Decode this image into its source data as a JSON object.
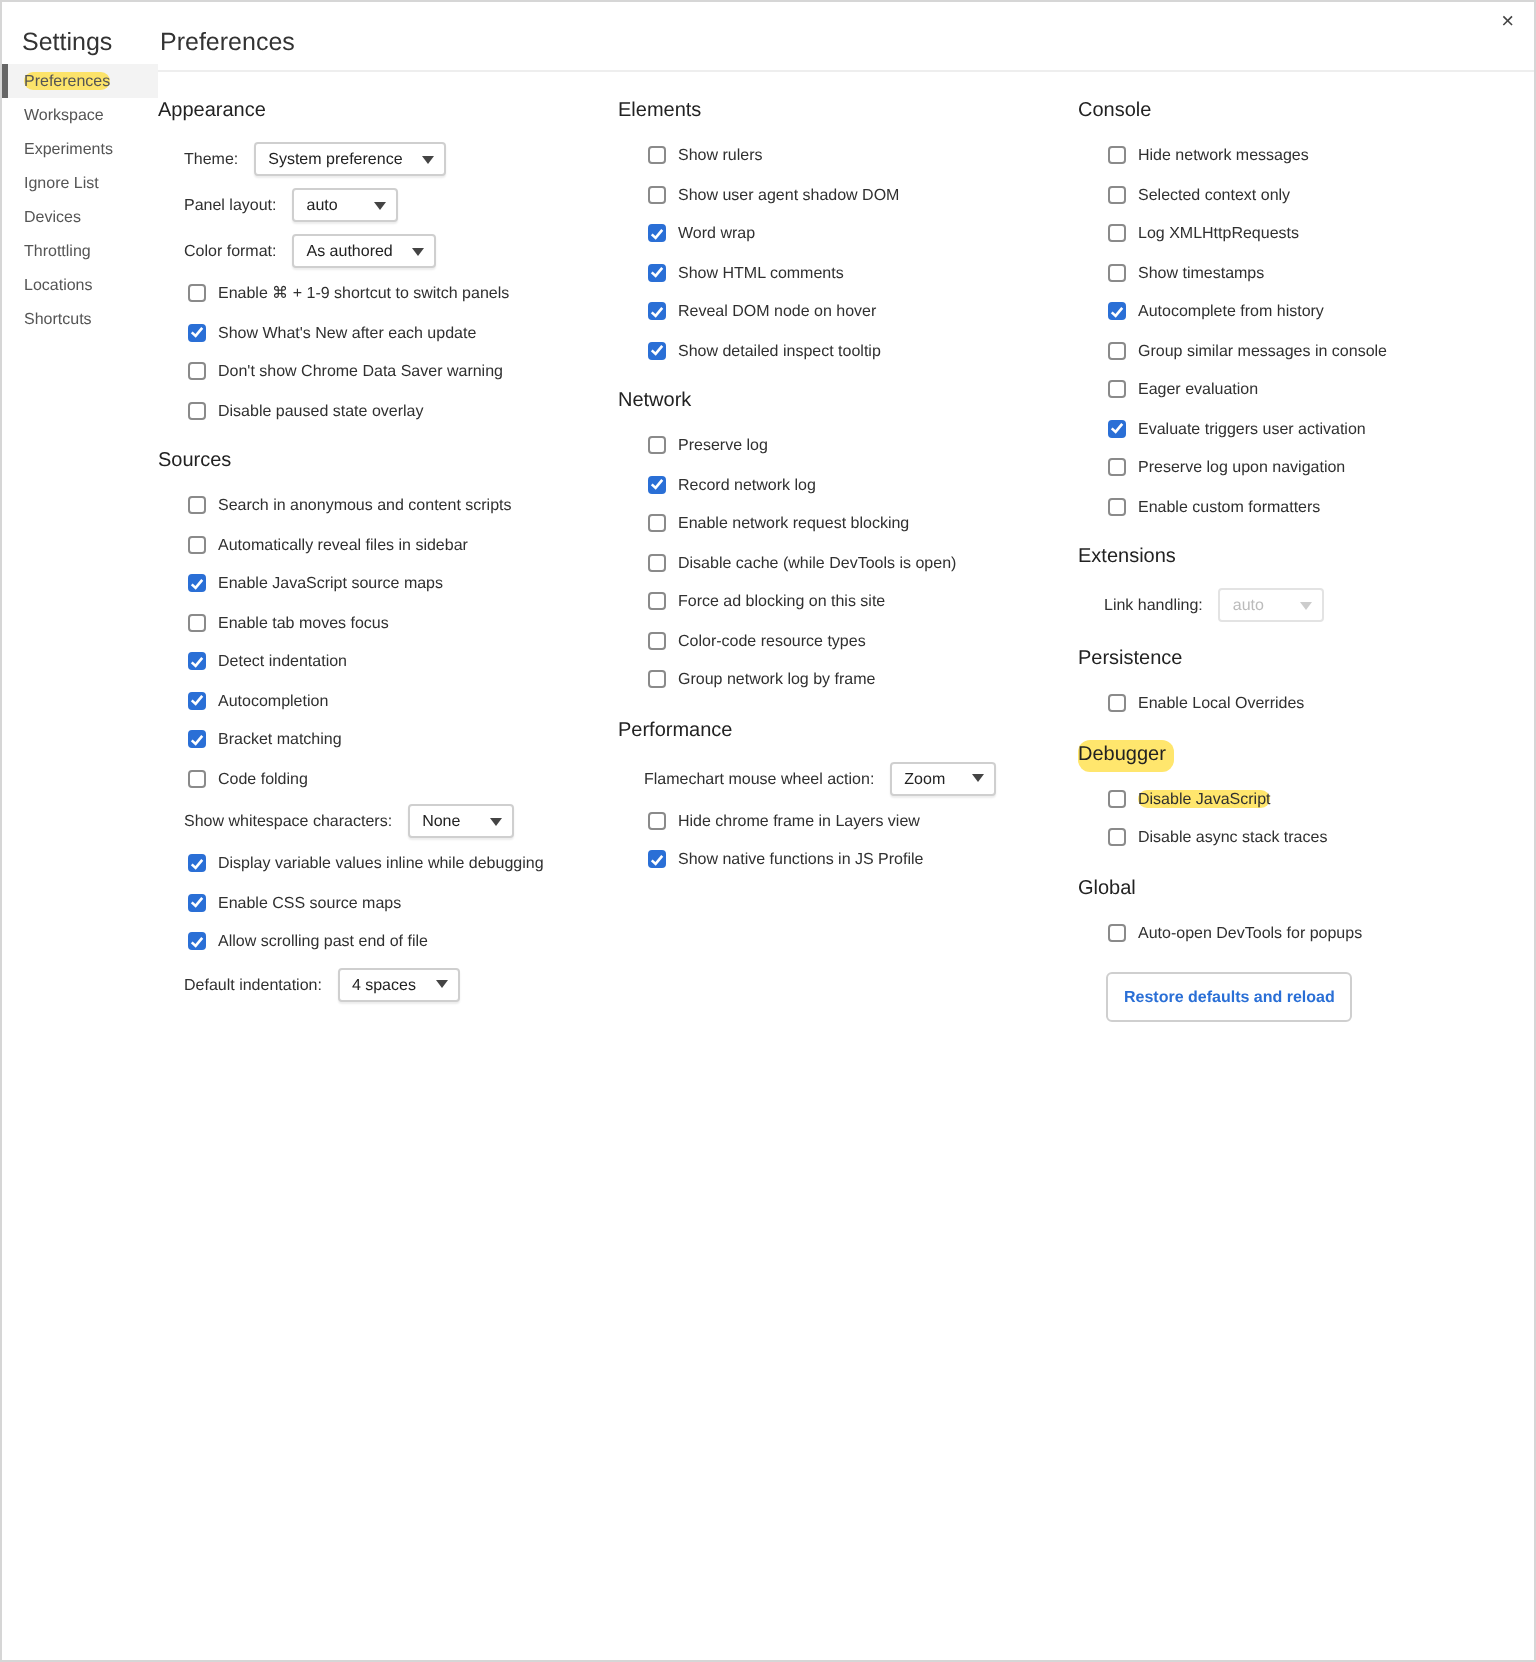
{
  "window": {
    "close": "×"
  },
  "sidebar": {
    "title": "Settings",
    "items": [
      {
        "label": "Preferences",
        "selected": true,
        "highlighted": true
      },
      {
        "label": "Workspace",
        "selected": false,
        "highlighted": false
      },
      {
        "label": "Experiments",
        "selected": false,
        "highlighted": false
      },
      {
        "label": "Ignore List",
        "selected": false,
        "highlighted": false
      },
      {
        "label": "Devices",
        "selected": false,
        "highlighted": false
      },
      {
        "label": "Throttling",
        "selected": false,
        "highlighted": false
      },
      {
        "label": "Locations",
        "selected": false,
        "highlighted": false
      },
      {
        "label": "Shortcuts",
        "selected": false,
        "highlighted": false
      }
    ]
  },
  "page_title": "Preferences",
  "columns": [
    {
      "sections": [
        {
          "title": "Appearance",
          "highlighted": false,
          "items": [
            {
              "kind": "select",
              "label": "Theme:",
              "value": "System preference",
              "disabled": false
            },
            {
              "kind": "select",
              "label": "Panel layout:",
              "value": "auto",
              "disabled": false
            },
            {
              "kind": "select",
              "label": "Color format:",
              "value": "As authored",
              "disabled": false
            },
            {
              "kind": "checkbox",
              "label": "Enable ⌘ + 1-9 shortcut to switch panels",
              "checked": false,
              "highlighted": false
            },
            {
              "kind": "checkbox",
              "label": "Show What's New after each update",
              "checked": true,
              "highlighted": false
            },
            {
              "kind": "checkbox",
              "label": "Don't show Chrome Data Saver warning",
              "checked": false,
              "highlighted": false
            },
            {
              "kind": "checkbox",
              "label": "Disable paused state overlay",
              "checked": false,
              "highlighted": false
            }
          ]
        },
        {
          "title": "Sources",
          "highlighted": false,
          "items": [
            {
              "kind": "checkbox",
              "label": "Search in anonymous and content scripts",
              "checked": false,
              "highlighted": false
            },
            {
              "kind": "checkbox",
              "label": "Automatically reveal files in sidebar",
              "checked": false,
              "highlighted": false
            },
            {
              "kind": "checkbox",
              "label": "Enable JavaScript source maps",
              "checked": true,
              "highlighted": false
            },
            {
              "kind": "checkbox",
              "label": "Enable tab moves focus",
              "checked": false,
              "highlighted": false
            },
            {
              "kind": "checkbox",
              "label": "Detect indentation",
              "checked": true,
              "highlighted": false
            },
            {
              "kind": "checkbox",
              "label": "Autocompletion",
              "checked": true,
              "highlighted": false
            },
            {
              "kind": "checkbox",
              "label": "Bracket matching",
              "checked": true,
              "highlighted": false
            },
            {
              "kind": "checkbox",
              "label": "Code folding",
              "checked": false,
              "highlighted": false
            },
            {
              "kind": "select",
              "label": "Show whitespace characters:",
              "value": "None",
              "disabled": false
            },
            {
              "kind": "checkbox",
              "label": "Display variable values inline while debugging",
              "checked": true,
              "highlighted": false
            },
            {
              "kind": "checkbox",
              "label": "Enable CSS source maps",
              "checked": true,
              "highlighted": false
            },
            {
              "kind": "checkbox",
              "label": "Allow scrolling past end of file",
              "checked": true,
              "highlighted": false
            },
            {
              "kind": "select",
              "label": "Default indentation:",
              "value": "4 spaces",
              "disabled": false
            }
          ]
        }
      ]
    },
    {
      "sections": [
        {
          "title": "Elements",
          "highlighted": false,
          "items": [
            {
              "kind": "checkbox",
              "label": "Show rulers",
              "checked": false,
              "highlighted": false
            },
            {
              "kind": "checkbox",
              "label": "Show user agent shadow DOM",
              "checked": false,
              "highlighted": false
            },
            {
              "kind": "checkbox",
              "label": "Word wrap",
              "checked": true,
              "highlighted": false
            },
            {
              "kind": "checkbox",
              "label": "Show HTML comments",
              "checked": true,
              "highlighted": false
            },
            {
              "kind": "checkbox",
              "label": "Reveal DOM node on hover",
              "checked": true,
              "highlighted": false
            },
            {
              "kind": "checkbox",
              "label": "Show detailed inspect tooltip",
              "checked": true,
              "highlighted": false
            }
          ]
        },
        {
          "title": "Network",
          "highlighted": false,
          "items": [
            {
              "kind": "checkbox",
              "label": "Preserve log",
              "checked": false,
              "highlighted": false
            },
            {
              "kind": "checkbox",
              "label": "Record network log",
              "checked": true,
              "highlighted": false
            },
            {
              "kind": "checkbox",
              "label": "Enable network request blocking",
              "checked": false,
              "highlighted": false
            },
            {
              "kind": "checkbox",
              "label": "Disable cache (while DevTools is open)",
              "checked": false,
              "highlighted": false
            },
            {
              "kind": "checkbox",
              "label": "Force ad blocking on this site",
              "checked": false,
              "highlighted": false
            },
            {
              "kind": "checkbox",
              "label": "Color-code resource types",
              "checked": false,
              "highlighted": false
            },
            {
              "kind": "checkbox",
              "label": "Group network log by frame",
              "checked": false,
              "highlighted": false
            }
          ]
        },
        {
          "title": "Performance",
          "highlighted": false,
          "items": [
            {
              "kind": "select",
              "label": "Flamechart mouse wheel action:",
              "value": "Zoom",
              "disabled": false
            },
            {
              "kind": "checkbox",
              "label": "Hide chrome frame in Layers view",
              "checked": false,
              "highlighted": false
            },
            {
              "kind": "checkbox",
              "label": "Show native functions in JS Profile",
              "checked": true,
              "highlighted": false
            }
          ]
        }
      ]
    },
    {
      "sections": [
        {
          "title": "Console",
          "highlighted": false,
          "items": [
            {
              "kind": "checkbox",
              "label": "Hide network messages",
              "checked": false,
              "highlighted": false
            },
            {
              "kind": "checkbox",
              "label": "Selected context only",
              "checked": false,
              "highlighted": false
            },
            {
              "kind": "checkbox",
              "label": "Log XMLHttpRequests",
              "checked": false,
              "highlighted": false
            },
            {
              "kind": "checkbox",
              "label": "Show timestamps",
              "checked": false,
              "highlighted": false
            },
            {
              "kind": "checkbox",
              "label": "Autocomplete from history",
              "checked": true,
              "highlighted": false
            },
            {
              "kind": "checkbox",
              "label": "Group similar messages in console",
              "checked": false,
              "highlighted": false
            },
            {
              "kind": "checkbox",
              "label": "Eager evaluation",
              "checked": false,
              "highlighted": false
            },
            {
              "kind": "checkbox",
              "label": "Evaluate triggers user activation",
              "checked": true,
              "highlighted": false
            },
            {
              "kind": "checkbox",
              "label": "Preserve log upon navigation",
              "checked": false,
              "highlighted": false
            },
            {
              "kind": "checkbox",
              "label": "Enable custom formatters",
              "checked": false,
              "highlighted": false
            }
          ]
        },
        {
          "title": "Extensions",
          "highlighted": false,
          "items": [
            {
              "kind": "select",
              "label": "Link handling:",
              "value": "auto",
              "disabled": true
            }
          ]
        },
        {
          "title": "Persistence",
          "highlighted": false,
          "items": [
            {
              "kind": "checkbox",
              "label": "Enable Local Overrides",
              "checked": false,
              "highlighted": false
            }
          ]
        },
        {
          "title": "Debugger",
          "highlighted": true,
          "items": [
            {
              "kind": "checkbox",
              "label": "Disable JavaScript",
              "checked": false,
              "highlighted": true
            },
            {
              "kind": "checkbox",
              "label": "Disable async stack traces",
              "checked": false,
              "highlighted": false
            }
          ]
        },
        {
          "title": "Global",
          "highlighted": false,
          "items": [
            {
              "kind": "checkbox",
              "label": "Auto-open DevTools for popups",
              "checked": false,
              "highlighted": false
            },
            {
              "kind": "button",
              "label": "Restore defaults and reload"
            }
          ]
        }
      ]
    }
  ]
}
